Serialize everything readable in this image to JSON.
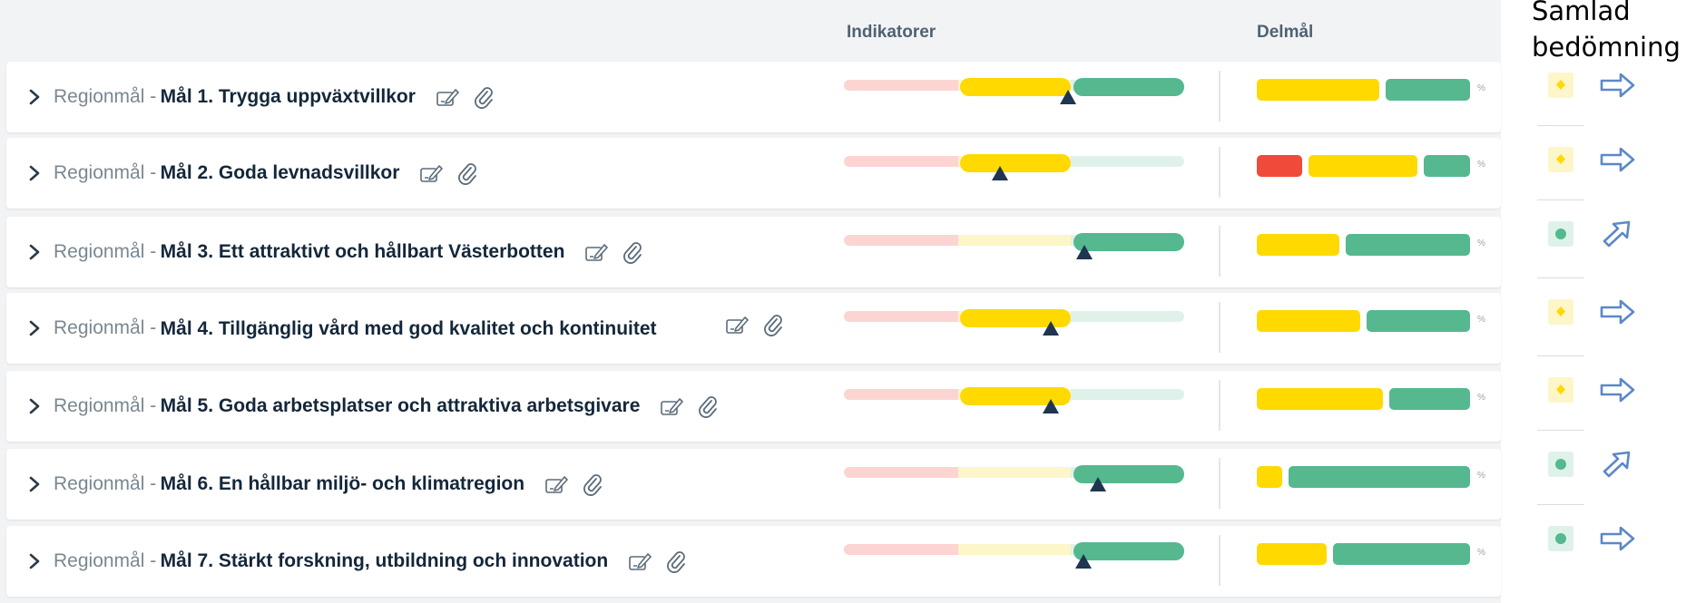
{
  "header": {
    "indicators_label": "Indikatorer",
    "subgoals_label": "Delmål",
    "assessment_line1": "Samlad",
    "assessment_line2": "bedömning"
  },
  "prefix": "Regionmål -",
  "percent_sign": "%",
  "colors": {
    "red": "#f04a3a",
    "red_light": "#fcd4d2",
    "yellow": "#ffd900",
    "yellow_light": "#fdf6c9",
    "green": "#55b88f",
    "green_light": "#dff2ea",
    "marker": "#1f3550",
    "arrow": "#5c88c8"
  },
  "rows": [
    {
      "goal": "Mål 1. Trygga uppväxtvillkor",
      "subgoals": [
        "yellow",
        "green"
      ],
      "assessment": {
        "status": "yellow-diamond-icon",
        "trend": "arrow-right-icon"
      }
    },
    {
      "goal": "Mål 2. Goda levnadsvillkor",
      "subgoals": [
        "red",
        "yellow",
        "green"
      ],
      "assessment": {
        "status": "yellow-diamond-icon",
        "trend": "arrow-right-icon"
      }
    },
    {
      "goal": "Mål 3. Ett attraktivt och hållbart Västerbotten",
      "subgoals": [
        "yellow",
        "green"
      ],
      "assessment": {
        "status": "green-dot-icon",
        "trend": "arrow-up-right-icon"
      }
    },
    {
      "goal": "Mål 4. Tillgänglig vård med god kvalitet och kontinuitet",
      "subgoals": [
        "yellow",
        "green"
      ],
      "assessment": {
        "status": "yellow-diamond-icon",
        "trend": "arrow-right-icon"
      }
    },
    {
      "goal": "Mål 5. Goda arbetsplatser och attraktiva arbetsgivare",
      "subgoals": [
        "yellow",
        "green"
      ],
      "assessment": {
        "status": "yellow-diamond-icon",
        "trend": "arrow-right-icon"
      }
    },
    {
      "goal": "Mål 6. En hållbar miljö- och klimatregion",
      "subgoals": [
        "yellow",
        "green"
      ],
      "assessment": {
        "status": "green-dot-icon",
        "trend": "arrow-up-right-icon"
      }
    },
    {
      "goal": "Mål 7. Stärkt forskning, utbildning och innovation",
      "subgoals": [
        "yellow",
        "green"
      ],
      "assessment": {
        "status": "green-dot-icon",
        "trend": "arrow-right-icon"
      }
    }
  ]
}
